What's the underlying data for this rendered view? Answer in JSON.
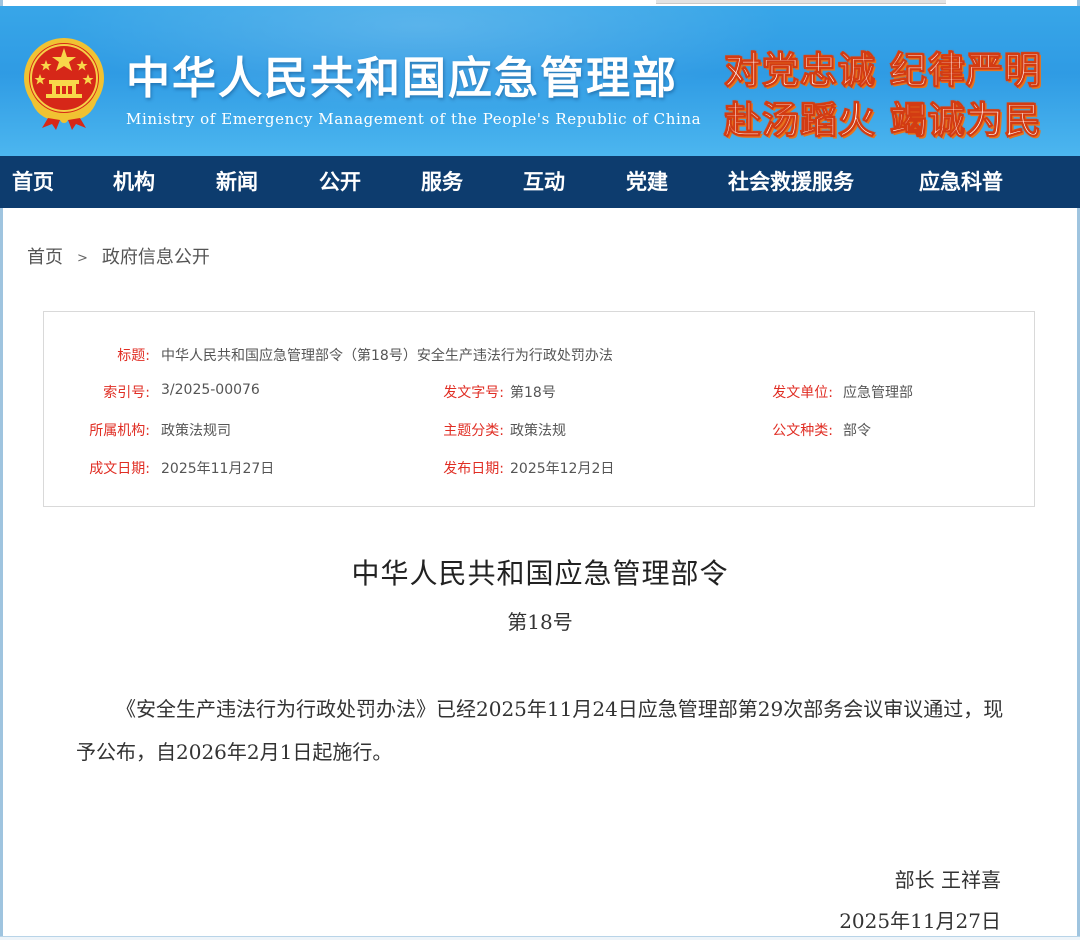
{
  "header": {
    "site_title": "中华人民共和国应急管理部",
    "site_subtitle": "Ministry of Emergency Management of the People's Republic of China",
    "slogan_line1": "对党忠诚  纪律严明",
    "slogan_line2": "赴汤蹈火  竭诚为民",
    "colors": {
      "banner": "#2f9be4",
      "nav": "#0d3c6e",
      "label_red": "#e02e24"
    }
  },
  "nav": {
    "items": [
      {
        "label": "首页"
      },
      {
        "label": "机构"
      },
      {
        "label": "新闻"
      },
      {
        "label": "公开"
      },
      {
        "label": "服务"
      },
      {
        "label": "互动"
      },
      {
        "label": "党建"
      },
      {
        "label": "社会救援服务"
      },
      {
        "label": "应急科普"
      }
    ]
  },
  "breadcrumb": {
    "home": "首页",
    "separator": ">",
    "current": "政府信息公开"
  },
  "info": {
    "title_label": "标题:",
    "title_value": "中华人民共和国应急管理部令（第18号）安全生产违法行为行政处罚办法",
    "index_label": "索引号:",
    "index_value": "3/2025-00076",
    "doc_no_label": "发文字号:",
    "doc_no_value": "第18号",
    "issuer_label": "发文单位:",
    "issuer_value": "应急管理部",
    "org_label": "所属机构:",
    "org_value": "政策法规司",
    "topic_label": "主题分类:",
    "topic_value": "政策法规",
    "type_label": "公文种类:",
    "type_value": "部令",
    "written_label": "成文日期:",
    "written_value": "2025年11月27日",
    "published_label": "发布日期:",
    "published_value": "2025年12月2日"
  },
  "document": {
    "title": "中华人民共和国应急管理部令",
    "number": "第18号",
    "body": "《安全生产违法行为行政处罚办法》已经2025年11月24日应急管理部第29次部务会议审议通过，现予公布，自2026年2月1日起施行。",
    "signature": "部长  王祥喜",
    "date": "2025年11月27日"
  }
}
